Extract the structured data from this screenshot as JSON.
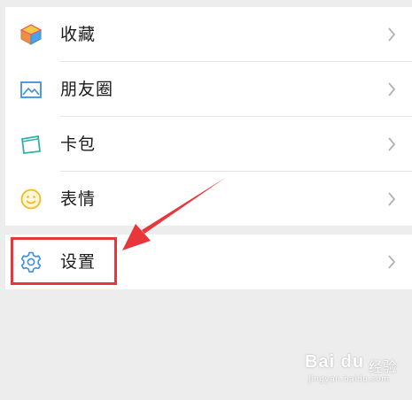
{
  "menu": {
    "items": [
      {
        "label": "收藏",
        "icon": "favorites-cube-icon"
      },
      {
        "label": "朋友圈",
        "icon": "moments-picture-icon"
      },
      {
        "label": "卡包",
        "icon": "card-wallet-icon"
      },
      {
        "label": "表情",
        "icon": "sticker-smiley-icon"
      }
    ],
    "settings": {
      "label": "设置",
      "icon": "settings-gear-icon"
    },
    "chevron_icon": "chevron-right-icon"
  },
  "annotation": {
    "highlight_color": "#e8363a",
    "arrow_color": "#e8363a"
  },
  "watermark": {
    "brand": "Bai du",
    "suffix": "经验",
    "url": "jingyan.baidu.com"
  },
  "colors": {
    "background": "#ededed",
    "card": "#ffffff",
    "text": "#1a1a1a",
    "chevron": "#b2b2b2"
  }
}
